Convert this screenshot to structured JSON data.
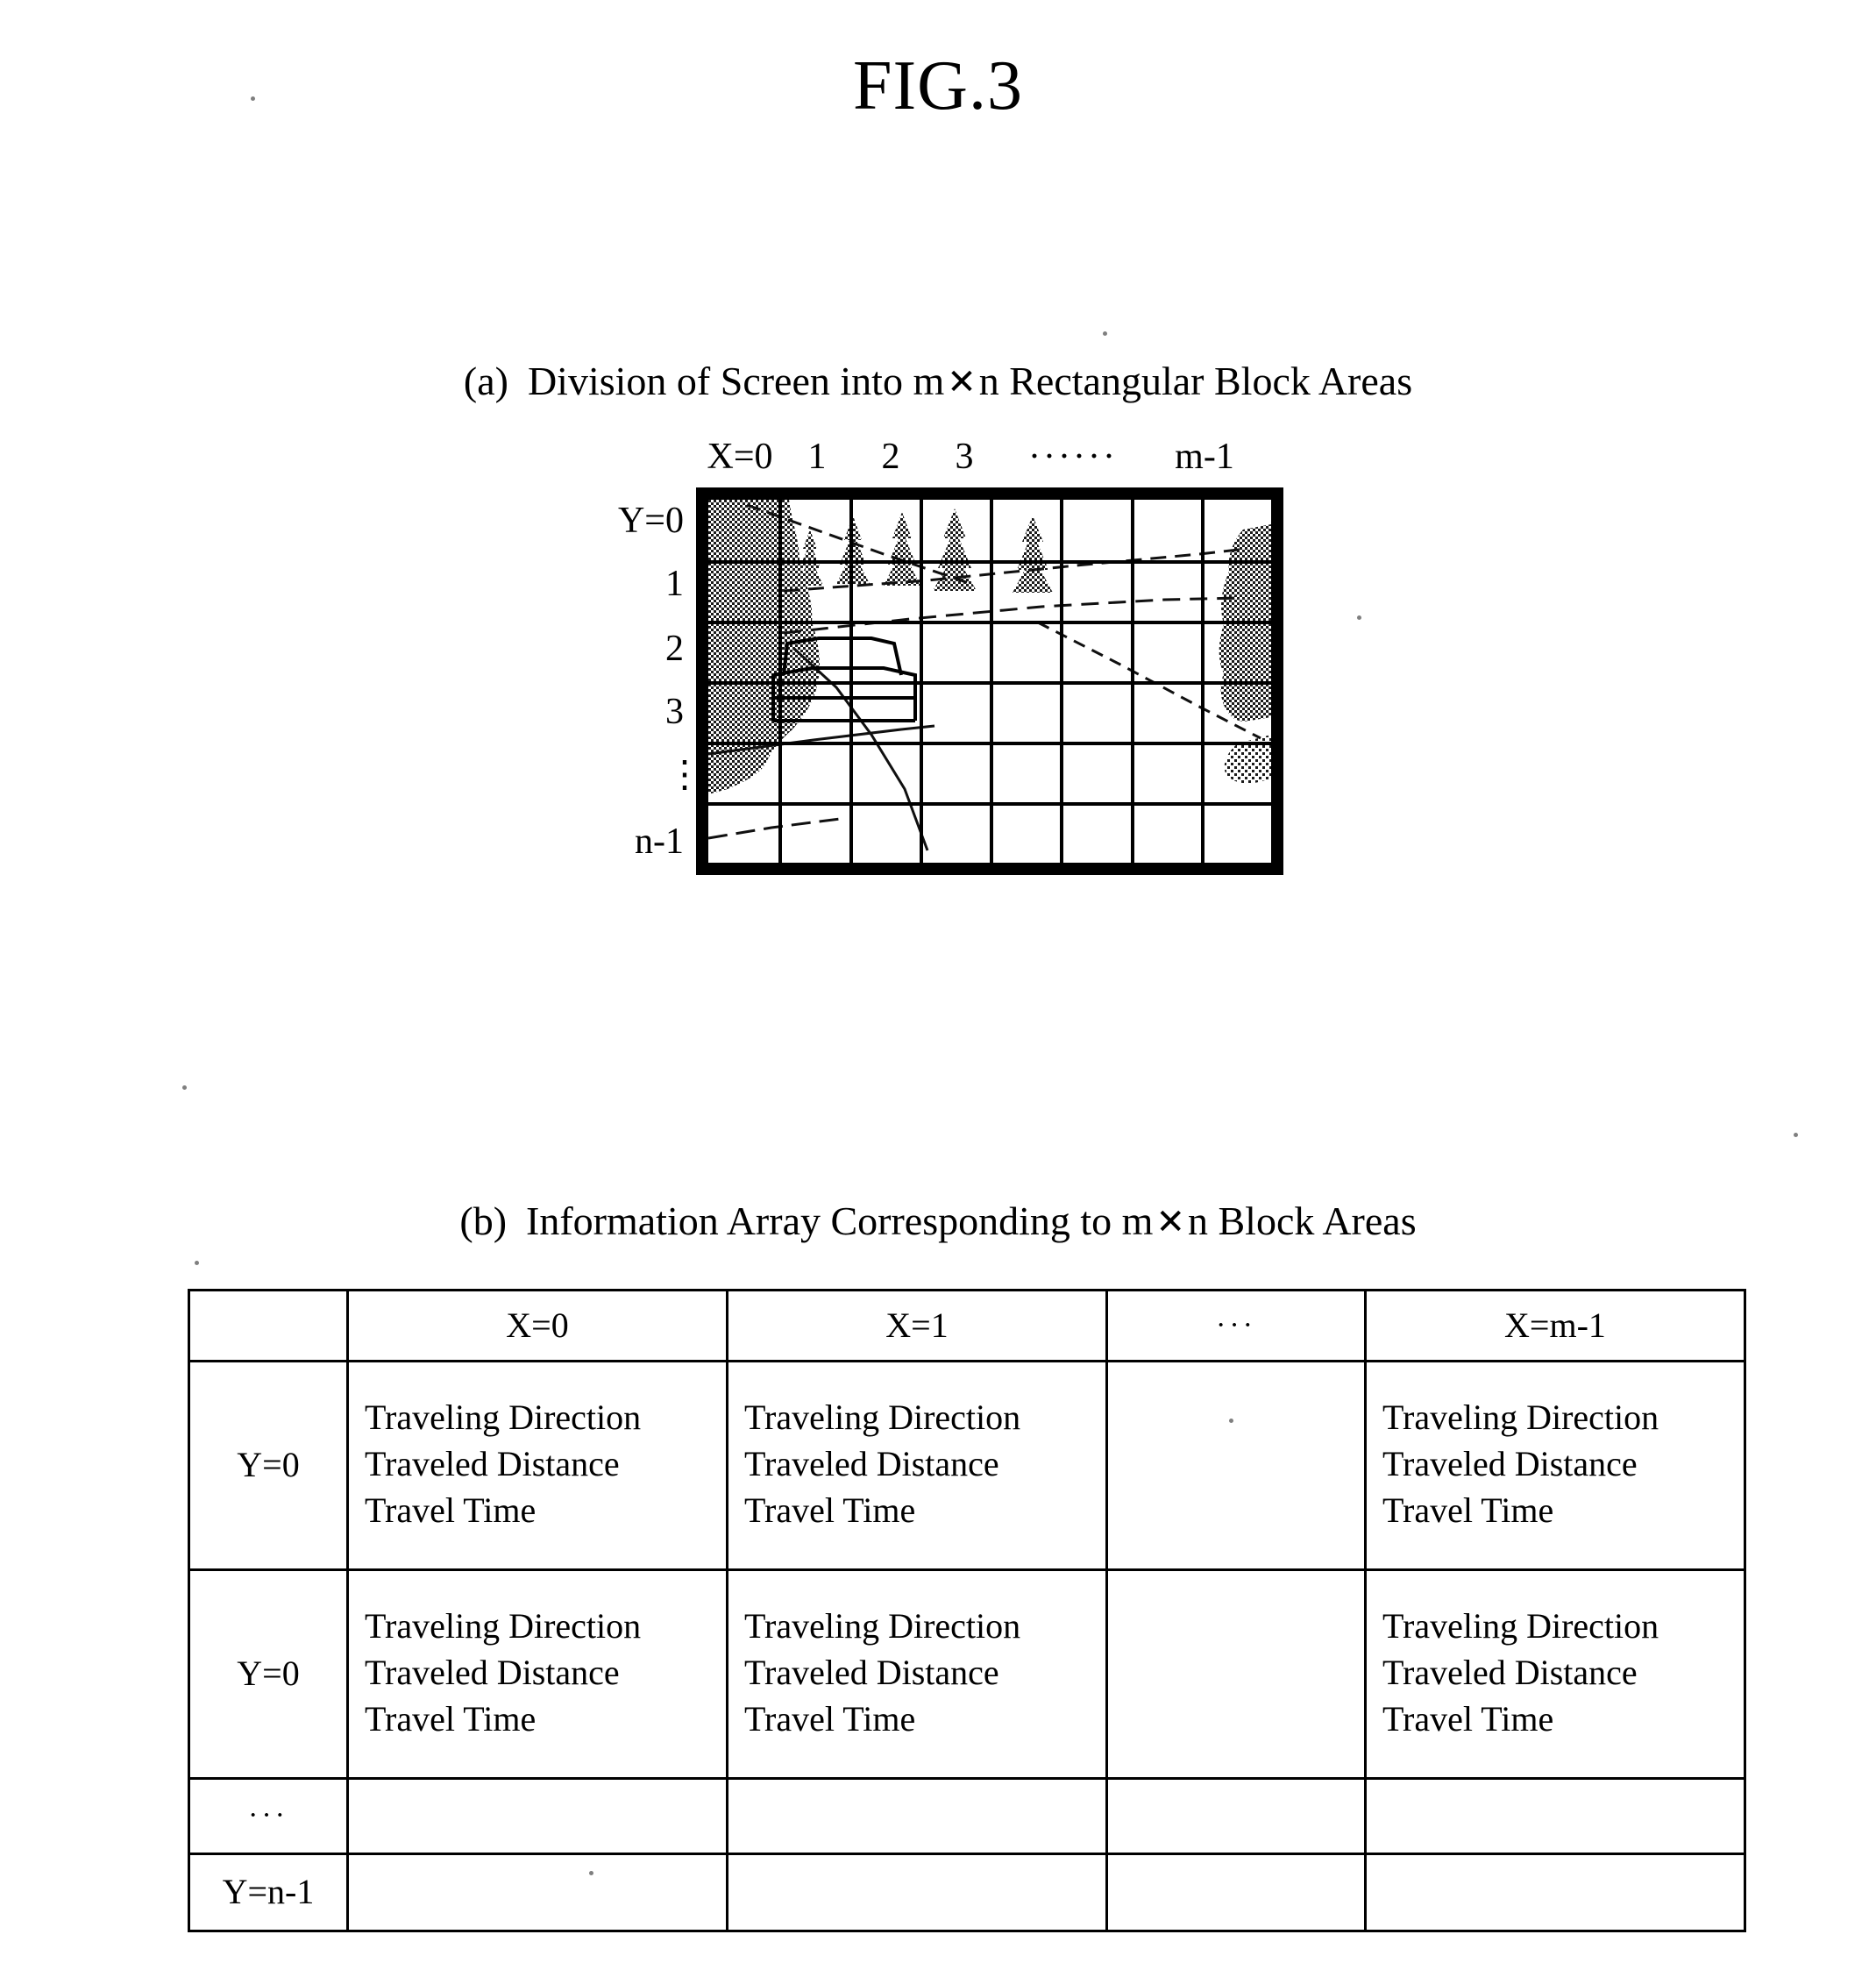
{
  "figure": {
    "title": "FIG.3"
  },
  "section_a": {
    "label": "(a)",
    "caption_before": "Division of Screen into m",
    "caption_times": "✕",
    "caption_after": "n Rectangular Block Areas",
    "column_labels": [
      "X=0",
      "1",
      "2",
      "3",
      "······",
      "m-1"
    ],
    "row_labels": [
      "Y=0",
      "1",
      "2",
      "3",
      "⋮",
      "n-1"
    ],
    "grid": {
      "columns": 8,
      "rows": 6
    },
    "scene": {
      "description": "road scene with roadside foliage, conifer trees and a vehicle",
      "elements": [
        "foliage-mass-left",
        "conifer-trees",
        "road-lines",
        "vehicle",
        "foliage-mass-right"
      ]
    }
  },
  "section_b": {
    "label": "(b)",
    "caption_before": "Information Array Corresponding to m",
    "caption_times": "✕",
    "caption_after": "n Block Areas",
    "table": {
      "corner": "",
      "headers": [
        "X=0",
        "X=1",
        "···",
        "X=m-1"
      ],
      "row_labels": [
        "Y=0",
        "Y=0",
        "···",
        "Y=n-1"
      ],
      "cell_lines": [
        "Traveling Direction",
        "Traveled Distance",
        "Travel Time"
      ],
      "rows": [
        {
          "label": "Y=0",
          "cells": [
            [
              "Traveling Direction",
              "Traveled Distance",
              "Travel Time"
            ],
            [
              "Traveling Direction",
              "Traveled Distance",
              "Travel Time"
            ],
            [],
            [
              "Traveling Direction",
              "Traveled Distance",
              "Travel Time"
            ]
          ]
        },
        {
          "label": "Y=0",
          "cells": [
            [
              "Traveling Direction",
              "Traveled Distance",
              "Travel Time"
            ],
            [
              "Traveling Direction",
              "Traveled Distance",
              "Travel Time"
            ],
            [],
            [
              "Traveling Direction",
              "Traveled Distance",
              "Travel Time"
            ]
          ]
        },
        {
          "label": "···",
          "cells": [
            [],
            [],
            [],
            []
          ]
        },
        {
          "label": "Y=n-1",
          "cells": [
            [],
            [],
            [],
            []
          ]
        }
      ]
    }
  },
  "colors": {
    "ink": "#000000",
    "paper": "#ffffff"
  }
}
